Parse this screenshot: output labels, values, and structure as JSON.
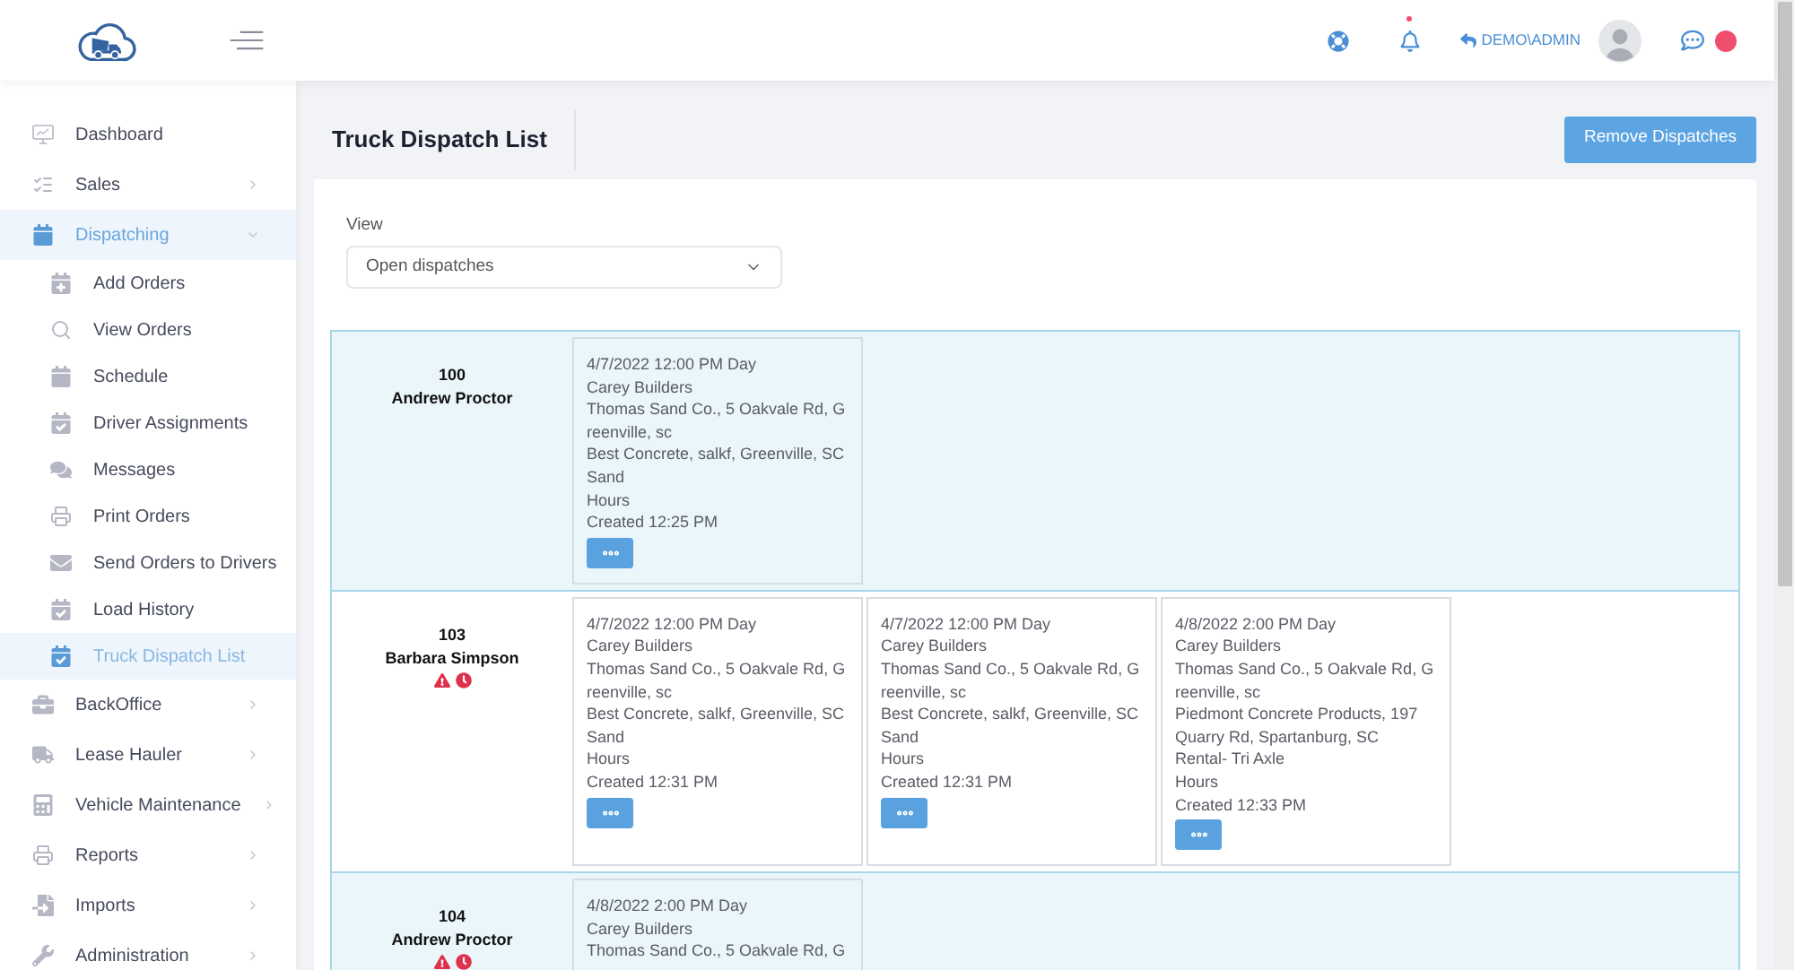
{
  "top_bar": {
    "user": "DEMO\\ADMIN"
  },
  "sidebar": {
    "items": [
      {
        "label": "Dashboard",
        "kind": "link",
        "selected": false
      },
      {
        "label": "Sales",
        "kind": "group",
        "expanded": false,
        "selected": false
      },
      {
        "label": "Dispatching",
        "kind": "group",
        "expanded": true,
        "selected": true,
        "children": [
          {
            "label": "Add Orders",
            "selected": false
          },
          {
            "label": "View Orders",
            "selected": false
          },
          {
            "label": "Schedule",
            "selected": false
          },
          {
            "label": "Driver Assignments",
            "selected": false
          },
          {
            "label": "Messages",
            "selected": false
          },
          {
            "label": "Print Orders",
            "selected": false
          },
          {
            "label": "Send Orders to Drivers",
            "selected": false
          },
          {
            "label": "Load History",
            "selected": false
          },
          {
            "label": "Truck Dispatch List",
            "selected": true
          }
        ]
      },
      {
        "label": "BackOffice",
        "kind": "group",
        "expanded": false,
        "selected": false
      },
      {
        "label": "Lease Hauler",
        "kind": "group",
        "expanded": false,
        "selected": false
      },
      {
        "label": "Vehicle Maintenance",
        "kind": "group",
        "expanded": false,
        "selected": false
      },
      {
        "label": "Reports",
        "kind": "group",
        "expanded": false,
        "selected": false
      },
      {
        "label": "Imports",
        "kind": "group",
        "expanded": false,
        "selected": false
      },
      {
        "label": "Administration",
        "kind": "group",
        "expanded": false,
        "selected": false
      }
    ]
  },
  "page": {
    "title": "Truck Dispatch List",
    "actions": [
      "Remove Dispatches"
    ]
  },
  "filter": {
    "label": "View",
    "value": "Open dispatches"
  },
  "trucks": [
    {
      "number": "100",
      "driver": "Andrew Proctor",
      "alerts": false,
      "dispatches": [
        {
          "time": "4/7/2022 12:00 PM Day",
          "customer": "Carey Builders",
          "load_at": "Thomas Sand Co., 5 Oakvale Rd, Greenville, sc",
          "deliver_to": "Best Concrete, salkf, Greenville, SC",
          "item": "Sand",
          "unit": "Hours",
          "created": "Created 12:25 PM"
        }
      ]
    },
    {
      "number": "103",
      "driver": "Barbara Simpson",
      "alerts": true,
      "dispatches": [
        {
          "time": "4/7/2022 12:00 PM Day",
          "customer": "Carey Builders",
          "load_at": "Thomas Sand Co., 5 Oakvale Rd, Greenville, sc",
          "deliver_to": "Best Concrete, salkf, Greenville, SC",
          "item": "Sand",
          "unit": "Hours",
          "created": "Created 12:31 PM"
        },
        {
          "time": "4/7/2022 12:00 PM Day",
          "customer": "Carey Builders",
          "load_at": "Thomas Sand Co., 5 Oakvale Rd, Greenville, sc",
          "deliver_to": "Best Concrete, salkf, Greenville, SC",
          "item": "Sand",
          "unit": "Hours",
          "created": "Created 12:31 PM"
        },
        {
          "time": "4/8/2022 2:00 PM Day",
          "customer": "Carey Builders",
          "load_at": "Thomas Sand Co., 5 Oakvale Rd, Greenville, sc",
          "deliver_to": "Piedmont Concrete Products, 197 Quarry Rd, Spartanburg, SC",
          "item": "Rental- Tri Axle",
          "unit": "Hours",
          "created": "Created 12:33 PM"
        }
      ]
    },
    {
      "number": "104",
      "driver": "Andrew Proctor",
      "alerts": true,
      "dispatches": [
        {
          "time": "4/8/2022 2:00 PM Day",
          "customer": "Carey Builders",
          "load_at": "Thomas Sand Co., 5 Oakvale Rd, G"
        }
      ]
    }
  ]
}
